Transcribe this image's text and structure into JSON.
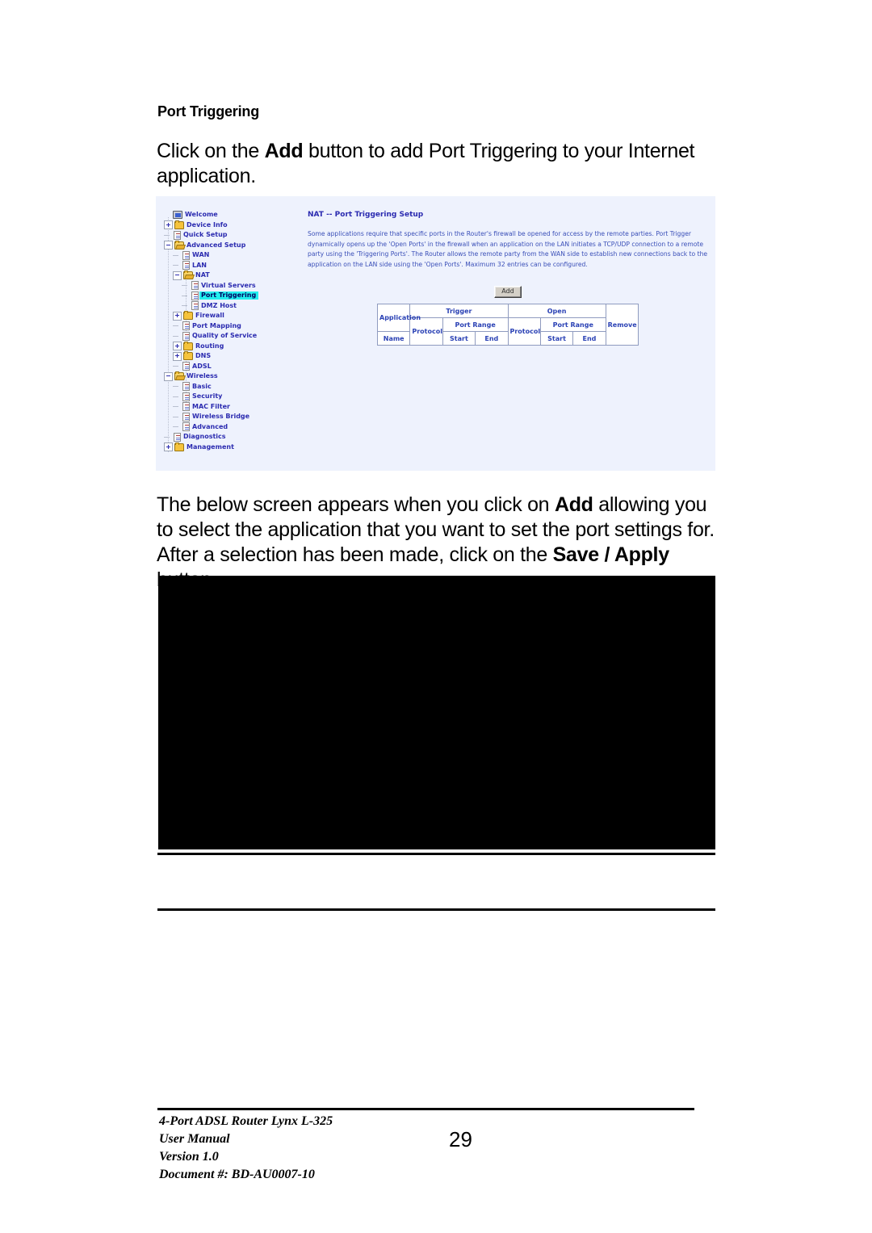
{
  "document": {
    "heading": "Port Triggering",
    "paragraph_1": {
      "before": "Click on the ",
      "bold": "Add",
      "after": " button to add Port Triggering to your Internet application."
    },
    "paragraph_2": {
      "seg1": "The below screen appears when you click on ",
      "bold1": "Add",
      "seg2": " allowing you to select the application that you want to set the port settings for. After a selection has been made, click on the ",
      "bold2": "Save / Apply",
      "seg3": " button."
    }
  },
  "router_screenshot": {
    "sidebar": {
      "items": [
        {
          "label": "Welcome",
          "icon": "monitor-icon",
          "indent": 0,
          "marker": "none"
        },
        {
          "label": "Device Info",
          "icon": "folder-icon",
          "indent": 0,
          "marker": "plus"
        },
        {
          "label": "Quick Setup",
          "icon": "page-icon",
          "indent": 0,
          "marker": "dash"
        },
        {
          "label": "Advanced Setup",
          "icon": "folder-open-icon",
          "indent": 0,
          "marker": "minus"
        },
        {
          "label": "WAN",
          "icon": "page-icon",
          "indent": 1,
          "marker": "dash"
        },
        {
          "label": "LAN",
          "icon": "page-icon",
          "indent": 1,
          "marker": "dash"
        },
        {
          "label": "NAT",
          "icon": "folder-open-icon",
          "indent": 1,
          "marker": "minus"
        },
        {
          "label": "Virtual Servers",
          "icon": "page-icon",
          "indent": 2,
          "marker": "dash"
        },
        {
          "label": "Port Triggering",
          "icon": "page-icon",
          "indent": 2,
          "marker": "dash",
          "selected": true
        },
        {
          "label": "DMZ Host",
          "icon": "page-icon",
          "indent": 2,
          "marker": "dash"
        },
        {
          "label": "Firewall",
          "icon": "folder-icon",
          "indent": 1,
          "marker": "plus"
        },
        {
          "label": "Port Mapping",
          "icon": "page-icon",
          "indent": 1,
          "marker": "dash"
        },
        {
          "label": "Quality of Service",
          "icon": "page-icon",
          "indent": 1,
          "marker": "dash"
        },
        {
          "label": "Routing",
          "icon": "folder-icon",
          "indent": 1,
          "marker": "plus"
        },
        {
          "label": "DNS",
          "icon": "folder-icon",
          "indent": 1,
          "marker": "plus"
        },
        {
          "label": "ADSL",
          "icon": "page-icon",
          "indent": 1,
          "marker": "dash"
        },
        {
          "label": "Wireless",
          "icon": "folder-open-icon",
          "indent": 0,
          "marker": "minus"
        },
        {
          "label": "Basic",
          "icon": "page-icon",
          "indent": 1,
          "marker": "dash"
        },
        {
          "label": "Security",
          "icon": "page-icon",
          "indent": 1,
          "marker": "dash"
        },
        {
          "label": "MAC Filter",
          "icon": "page-icon",
          "indent": 1,
          "marker": "dash"
        },
        {
          "label": "Wireless Bridge",
          "icon": "page-icon",
          "indent": 1,
          "marker": "dash"
        },
        {
          "label": "Advanced",
          "icon": "page-icon",
          "indent": 1,
          "marker": "dash"
        },
        {
          "label": "Diagnostics",
          "icon": "page-icon",
          "indent": 0,
          "marker": "dash"
        },
        {
          "label": "Management",
          "icon": "folder-icon",
          "indent": 0,
          "marker": "plus"
        }
      ],
      "selected_color": "#23efef",
      "link_color": "#2b2bb0"
    },
    "main": {
      "title": "NAT -- Port Triggering Setup",
      "description": "Some applications require that specific ports in the Router's firewall be opened for access by the remote parties. Port Trigger dynamically opens up the 'Open Ports' in the firewall when an application on the LAN initiates a TCP/UDP connection to a remote party using the 'Triggering Ports'. The Router allows the remote party from the WAN side to establish new connections back to the application on the LAN side using the 'Open Ports'. Maximum 32 entries can be configured.",
      "add_button": "Add",
      "table": {
        "row1": [
          "Application",
          "Trigger",
          "Open",
          "Remove"
        ],
        "row2": [
          "Name",
          "Protocol",
          "Port Range",
          "Protocol",
          "Port Range",
          ""
        ],
        "row3": [
          "",
          "",
          "Start",
          "End",
          "",
          "Start",
          "End",
          ""
        ]
      }
    },
    "background_color": "#eef2fd"
  },
  "second_screenshot": {
    "state": "blank",
    "background_color": "#000000"
  },
  "footer": {
    "product": "4-Port ADSL Router Lynx L-325",
    "manual": "User Manual",
    "version": "Version 1.0",
    "document_number": "Document #:  BD-AU0007-10",
    "page_number": "29"
  }
}
